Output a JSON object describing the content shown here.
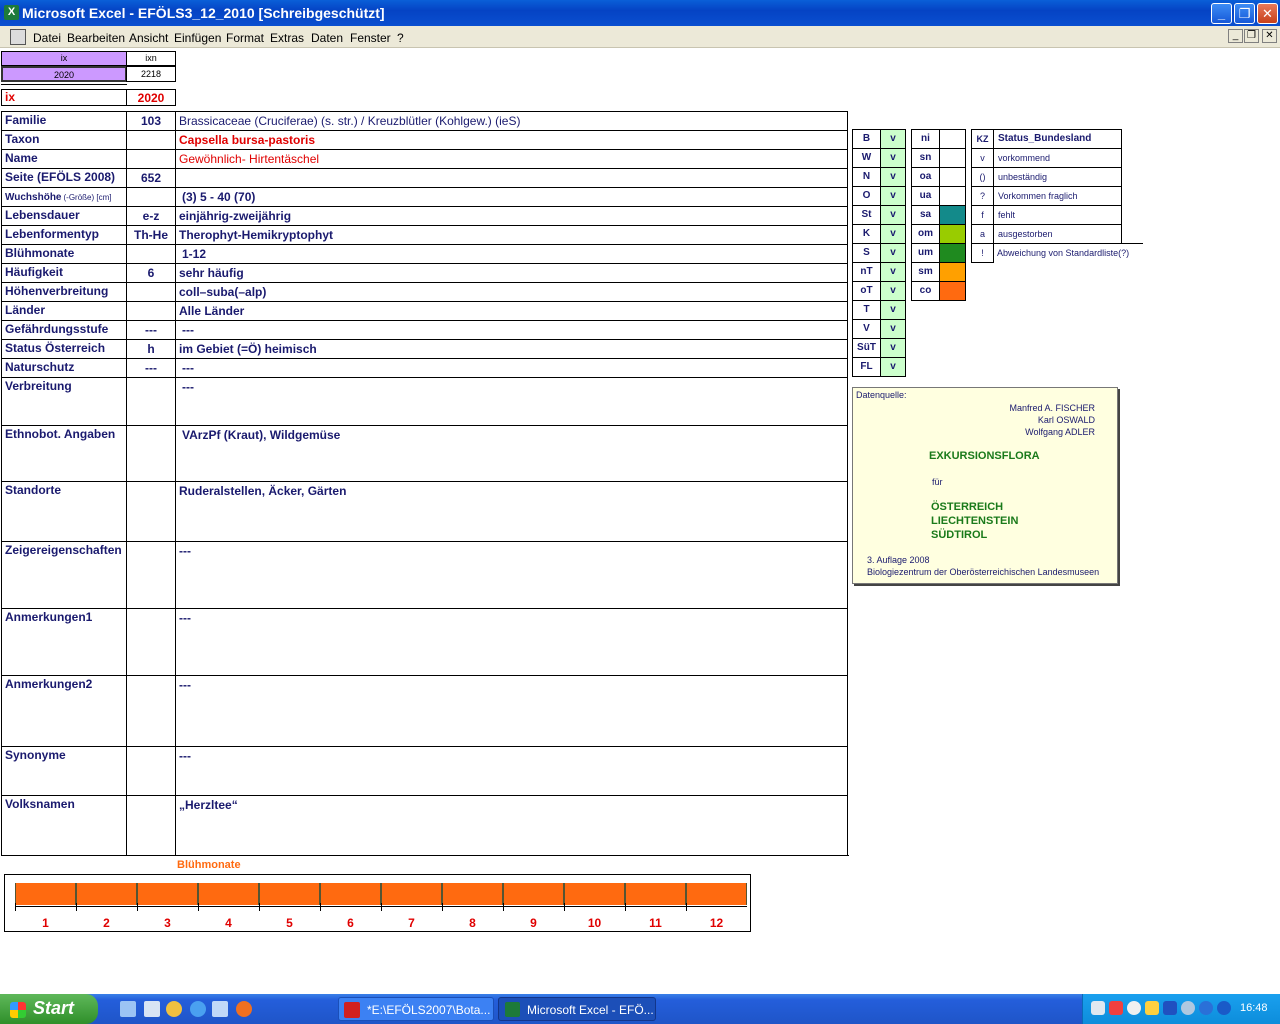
{
  "window": {
    "app_badge": "X",
    "title": "Microsoft Excel - EFÖLS3_12_2010  [Schreibgeschützt]",
    "buttons": [
      "_",
      "❐",
      "✕"
    ]
  },
  "menu": {
    "items": [
      "Datei",
      "Bearbeiten",
      "Ansicht",
      "Einfügen",
      "Format",
      "Extras",
      "Daten",
      "Fenster",
      "?"
    ],
    "doc_buttons": [
      "_",
      "❐",
      "✕"
    ]
  },
  "top": {
    "ix_header": "ix",
    "ixn_header": "ixn",
    "ix_value": "2020",
    "ixn_value": "2218",
    "ix_label": "ix",
    "ix_big": "2020"
  },
  "form": {
    "rows": [
      {
        "label": "Familie",
        "code": "103",
        "value": "Brassicaceae (Cruciferae) (s. str.)  /  Kreuzblütler (Kohlgew.) (ieS)"
      },
      {
        "label": "Taxon",
        "code": "",
        "value": "Capsella bursa-pastoris"
      },
      {
        "label": "Name",
        "code": "",
        "value": "Gewöhnlich- Hirtentäschel"
      },
      {
        "label": "Seite (EFÖLS 2008)",
        "code": "652",
        "value": ""
      },
      {
        "label": "Wuchshöhe",
        "label_suffix": "(-Größe) [cm]",
        "code": "",
        "value": "(3) 5 - 40 (70)"
      },
      {
        "label": "Lebensdauer",
        "code": "e-z",
        "value": "einjährig-zweijährig"
      },
      {
        "label": "Lebenformentyp",
        "code": "Th-He",
        "value": "Therophyt-Hemikryptophyt"
      },
      {
        "label": "Blühmonate",
        "code": "",
        "value": "1-12"
      },
      {
        "label": "Häufigkeit",
        "code": "6",
        "value": "sehr häufig"
      },
      {
        "label": "Höhenverbreitung",
        "code": "",
        "value": "coll–suba(–alp)"
      },
      {
        "label": "Länder",
        "code": "",
        "value": "Alle Länder"
      },
      {
        "label": "Gefährdungsstufe",
        "code": "---",
        "value": "---"
      },
      {
        "label": "Status Österreich",
        "code": "h",
        "value": "im Gebiet (=Ö) heimisch"
      },
      {
        "label": "Naturschutz",
        "code": "---",
        "value": "---"
      },
      {
        "label": "Verbreitung",
        "code": "",
        "value": "---"
      },
      {
        "label": "Ethnobot. Angaben",
        "code": "",
        "value": "VArzPf (Kraut), Wildgemüse"
      },
      {
        "label": "Standorte",
        "code": "",
        "value": "Ruderalstellen, Äcker, Gärten"
      },
      {
        "label": "Zeigereigenschaften",
        "code": "",
        "value": "---"
      },
      {
        "label": "Anmerkungen1",
        "code": "",
        "value": "---"
      },
      {
        "label": "Anmerkungen2",
        "code": "",
        "value": "---"
      },
      {
        "label": "Synonyme",
        "code": "",
        "value": "---"
      },
      {
        "label": "Volksnamen",
        "code": "",
        "value": "„Herzltee“"
      }
    ]
  },
  "regions": [
    {
      "code": "B",
      "status": "v"
    },
    {
      "code": "W",
      "status": "v"
    },
    {
      "code": "N",
      "status": "v"
    },
    {
      "code": "O",
      "status": "v"
    },
    {
      "code": "St",
      "status": "v"
    },
    {
      "code": "K",
      "status": "v"
    },
    {
      "code": "S",
      "status": "v"
    },
    {
      "code": "nT",
      "status": "v"
    },
    {
      "code": "oT",
      "status": "v"
    },
    {
      "code": "T",
      "status": "v"
    },
    {
      "code": "V",
      "status": "v"
    },
    {
      "code": "SüT",
      "status": "v"
    },
    {
      "code": "FL",
      "status": "v"
    }
  ],
  "altitude": [
    {
      "code": "ni",
      "color": ""
    },
    {
      "code": "sn",
      "color": ""
    },
    {
      "code": "oa",
      "color": ""
    },
    {
      "code": "ua",
      "color": ""
    },
    {
      "code": "sa",
      "color": "#138a8a"
    },
    {
      "code": "om",
      "color": "#99cc00"
    },
    {
      "code": "um",
      "color": "#1f8a1f"
    },
    {
      "code": "sm",
      "color": "#ffa000"
    },
    {
      "code": "co",
      "color": "#ff6a10"
    }
  ],
  "status_legend": {
    "header_kz": "KZ",
    "header_title": "Status_Bundesland",
    "items": [
      {
        "kz": "v",
        "text": "vorkommend"
      },
      {
        "kz": "()",
        "text": "unbeständig"
      },
      {
        "kz": "?",
        "text": "Vorkommen fraglich"
      },
      {
        "kz": "f",
        "text": "fehlt"
      },
      {
        "kz": "a",
        "text": "ausgestorben"
      },
      {
        "kz": "!",
        "text": "Abweichung von Standardliste(?)"
      }
    ]
  },
  "source": {
    "label": "Datenquelle:",
    "authors": [
      "Manfred A. FISCHER",
      "Karl OSWALD",
      "Wolfgang ADLER"
    ],
    "book": "EXKURSIONSFLORA",
    "fuer": "für",
    "countries": [
      "ÖSTERREICH",
      "LIECHTENSTEIN",
      "SÜDTIROL"
    ],
    "edition": "3. Auflage 2008",
    "publisher": "Biologiezentrum der Oberösterreichischen Landesmuseen"
  },
  "bloom": {
    "title": "Blühmonate",
    "months": [
      "1",
      "2",
      "3",
      "4",
      "5",
      "6",
      "7",
      "8",
      "9",
      "10",
      "11",
      "12"
    ],
    "bar_color": "#ff6a10"
  },
  "taskbar": {
    "start": "Start",
    "tasks": [
      "*E:\\EFÖLS2007\\Bota...",
      "Microsoft Excel - EFÖ..."
    ],
    "clock": "16:48"
  }
}
